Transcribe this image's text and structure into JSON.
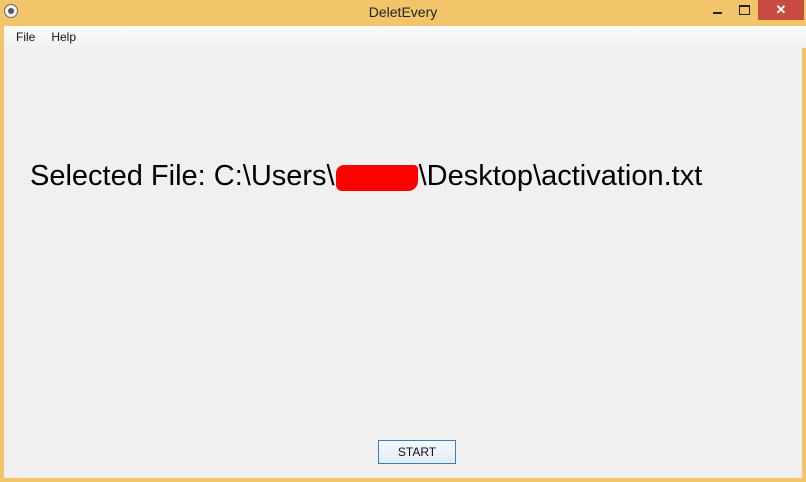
{
  "window": {
    "title": "DeletEvery",
    "close_symbol": "✕"
  },
  "icons": {
    "app": "app-icon",
    "minimize": "minimize-icon",
    "maximize": "maximize-icon",
    "close": "close-icon"
  },
  "colors": {
    "title_bar": "#f2c56a",
    "client_bg": "#f0f0f0",
    "close_button": "#c74b40",
    "redaction": "#fe0000",
    "button_border": "#3c7fb1"
  },
  "menu": {
    "items": [
      {
        "label": "File"
      },
      {
        "label": "Help"
      }
    ]
  },
  "main": {
    "selected_file_prefix": "Selected File: C:\\Users\\",
    "selected_file_suffix": "\\Desktop\\activation.txt",
    "start_label": "START"
  }
}
